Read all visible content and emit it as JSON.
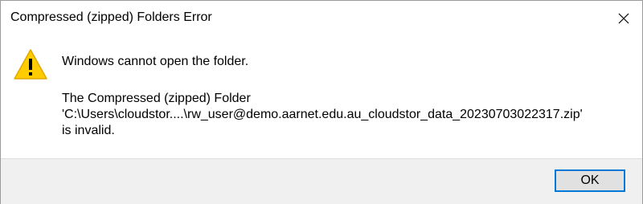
{
  "window": {
    "title": "Compressed (zipped) Folders Error",
    "close_icon": "close-icon"
  },
  "message": {
    "icon": "warning-icon",
    "main": "Windows cannot open the folder.",
    "detail_lines": [
      "The Compressed (zipped) Folder",
      "'C:\\Users\\cloudstor....\\rw_user@demo.aarnet.edu.au_cloudstor_data_20230703022317.zip'",
      "is invalid."
    ]
  },
  "buttons": {
    "ok_label": "OK"
  },
  "colors": {
    "accent": "#0078d7",
    "warning_fill": "#ffcc00",
    "footer_bg": "#f0f0f0"
  }
}
